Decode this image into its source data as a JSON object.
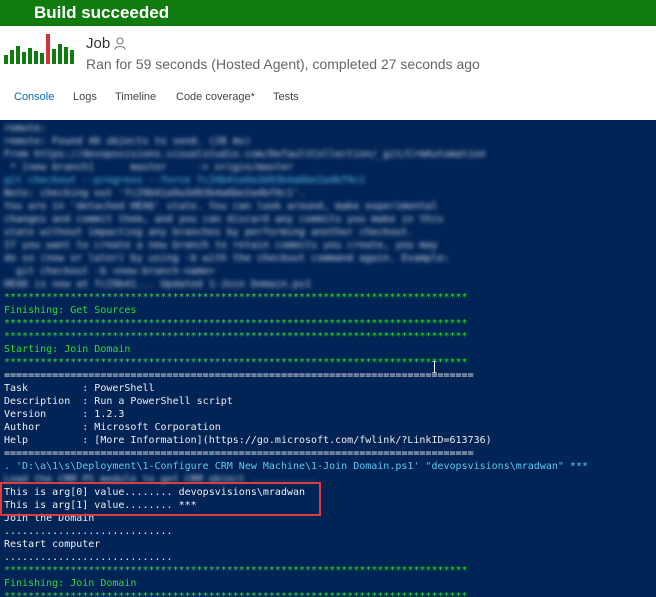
{
  "banner": {
    "status": "Build succeeded",
    "color": "#107c10"
  },
  "job": {
    "name": "Job",
    "person_icon": "person-icon",
    "summary": "Ran for 59 seconds (Hosted Agent), completed 27 seconds ago"
  },
  "tabs": [
    {
      "label": "Console",
      "active": true
    },
    {
      "label": "Logs",
      "active": false
    },
    {
      "label": "Timeline",
      "active": false
    },
    {
      "label": "Code coverage*",
      "active": false
    },
    {
      "label": "Tests",
      "active": false
    }
  ],
  "console": {
    "background": "#012456",
    "blurred_lines": [
      "remote:",
      "remote: Found 40 objects to send. (28 ms)",
      "From https://devopsvisions.visualstudio.com/DefaultCollection/_git/CrmAutomation",
      " * [new branch]      master     -> origin/master",
      "git checkout --progress --force fc29b41a9a3d93b4a6be2a4bf9c1",
      "Note: checking out 'fc29b41a9a3d93b4a6be2a4bf9c1'.",
      "You are in 'detached HEAD' state. You can look around, make experimental",
      "changes and commit them, and you can discard any commits you make in this",
      "state without impacting any branches by performing another checkout.",
      "If you want to create a new branch to retain commits you create, you may",
      "do so (now or later) by using -b with the checkout command again. Example:",
      "  git checkout -b <new-branch-name>",
      "HEAD is now at fc29b41... Updated 1-Join Domain.ps1"
    ],
    "separator_stars": "*****************************************************************************",
    "separator_equals": "==============================================================================",
    "finishing_get_sources": "Finishing: Get Sources",
    "starting_join_domain": "Starting: Join Domain",
    "task_info": [
      "Task         : PowerShell",
      "Description  : Run a PowerShell script",
      "Version      : 1.2.3",
      "Author       : Microsoft Corporation",
      "Help         : [More Information](https://go.microsoft.com/fwlink/?LinkID=613736)"
    ],
    "command": ". 'D:\\a\\1\\s\\Deployment\\1-Configure CRM New Machine\\1-Join Domain.ps1' \"devopsvisions\\mradwan\" ***",
    "blurred_command_output": "Load the CRM PS module to get CRM object ...........",
    "arg0": "This is arg[0] value........ devopsvisions\\mradwan",
    "arg1": "This is arg[1] value........ ***",
    "join_domain_text": "Join the Domain",
    "dots1": "............................",
    "restart": "Restart computer",
    "dots2": "............................",
    "finishing_join_domain": "Finishing: Join Domain",
    "highlight_color": "#e03c3c",
    "green_color": "#2fdc2f"
  }
}
